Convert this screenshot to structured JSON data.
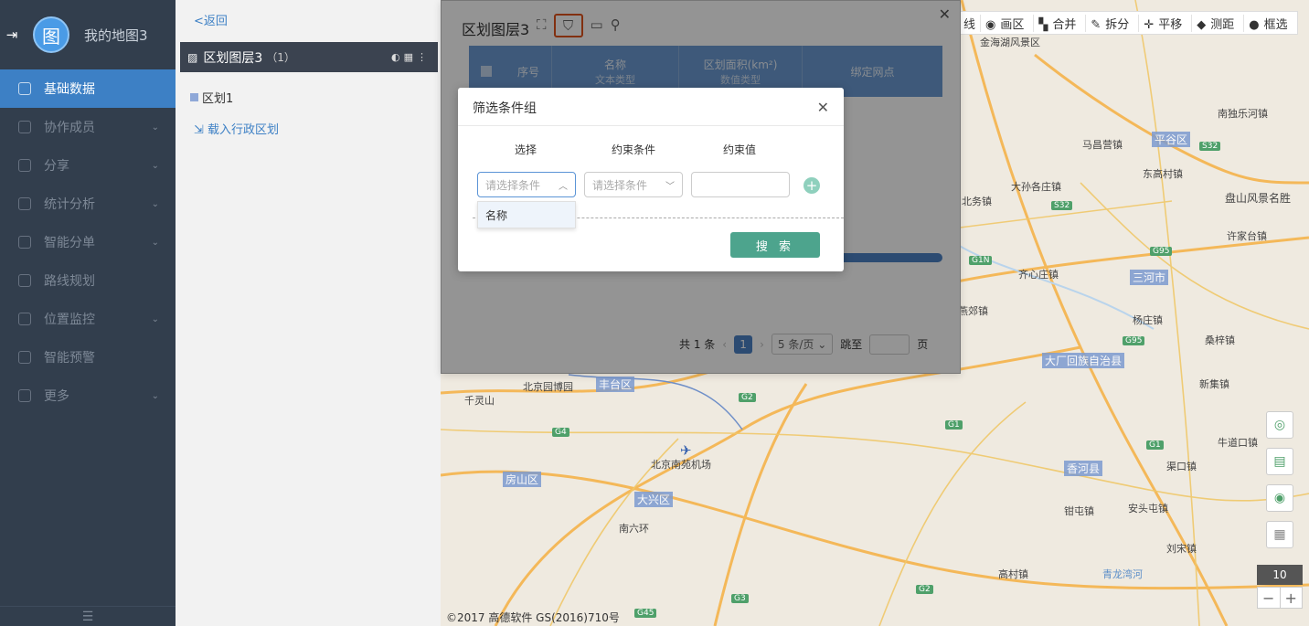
{
  "app": {
    "name": "我的地图3",
    "logo_char": "图"
  },
  "sidebar": {
    "items": [
      {
        "label": "基础数据",
        "active": true,
        "expandable": false
      },
      {
        "label": "协作成员",
        "active": false,
        "expandable": true
      },
      {
        "label": "分享",
        "active": false,
        "expandable": true
      },
      {
        "label": "统计分析",
        "active": false,
        "expandable": true
      },
      {
        "label": "智能分单",
        "active": false,
        "expandable": true
      },
      {
        "label": "路线规划",
        "active": false,
        "expandable": false
      },
      {
        "label": "位置监控",
        "active": false,
        "expandable": true
      },
      {
        "label": "智能预警",
        "active": false,
        "expandable": false
      },
      {
        "label": "更多",
        "active": false,
        "expandable": true
      }
    ],
    "footer_icon": "menu-collapse-icon"
  },
  "panel": {
    "back_label": "<返回",
    "layer_name": "区划图层3",
    "layer_count": "（1）",
    "region_name": "区划1",
    "load_label": "载入行政区划"
  },
  "table_window": {
    "title": "区划图层3",
    "columns": [
      {
        "label": "序号",
        "sub": ""
      },
      {
        "label": "名称",
        "sub": "文本类型"
      },
      {
        "label": "区划面积(km²)",
        "sub": "数值类型"
      },
      {
        "label": "绑定网点",
        "sub": ""
      }
    ],
    "pager": {
      "total": "共 1 条",
      "page": "1",
      "per_page": "5 条/页",
      "jump_label": "跳至",
      "page_unit": "页"
    }
  },
  "map": {
    "toolbar": [
      "线",
      "画区",
      "合并",
      "拆分",
      "平移",
      "测距",
      "框选"
    ],
    "zoom_level": "10",
    "copyright": "©2017 高德软件 GS(2016)710号",
    "labels": [
      "北京园博园",
      "千灵山",
      "丰台区",
      "房山区",
      "北京南苑机场",
      "大兴区",
      "南六环",
      "马昌营镇",
      "平谷区",
      "东高村镇",
      "大孙各庄镇",
      "盘山风景名胜",
      "许家台镇",
      "北务镇",
      "齐心庄镇",
      "三河市",
      "杨庄镇",
      "燕郊镇",
      "桑梓镇",
      "大厂回族自治县",
      "新集镇",
      "香河县",
      "高村镇",
      "刘宋镇",
      "安头屯镇",
      "南独乐河镇",
      "牛道口镇",
      "渠口镇",
      "钳屯镇",
      "青龙湾河",
      "金海湖风景区"
    ]
  },
  "dialog": {
    "title": "筛选条件组",
    "headers": [
      "选择",
      "约束条件",
      "约束值"
    ],
    "select_placeholder": "请选择条件",
    "constraint_placeholder": "请选择条件",
    "dropdown_option": "名称",
    "search_label": "搜 索"
  }
}
